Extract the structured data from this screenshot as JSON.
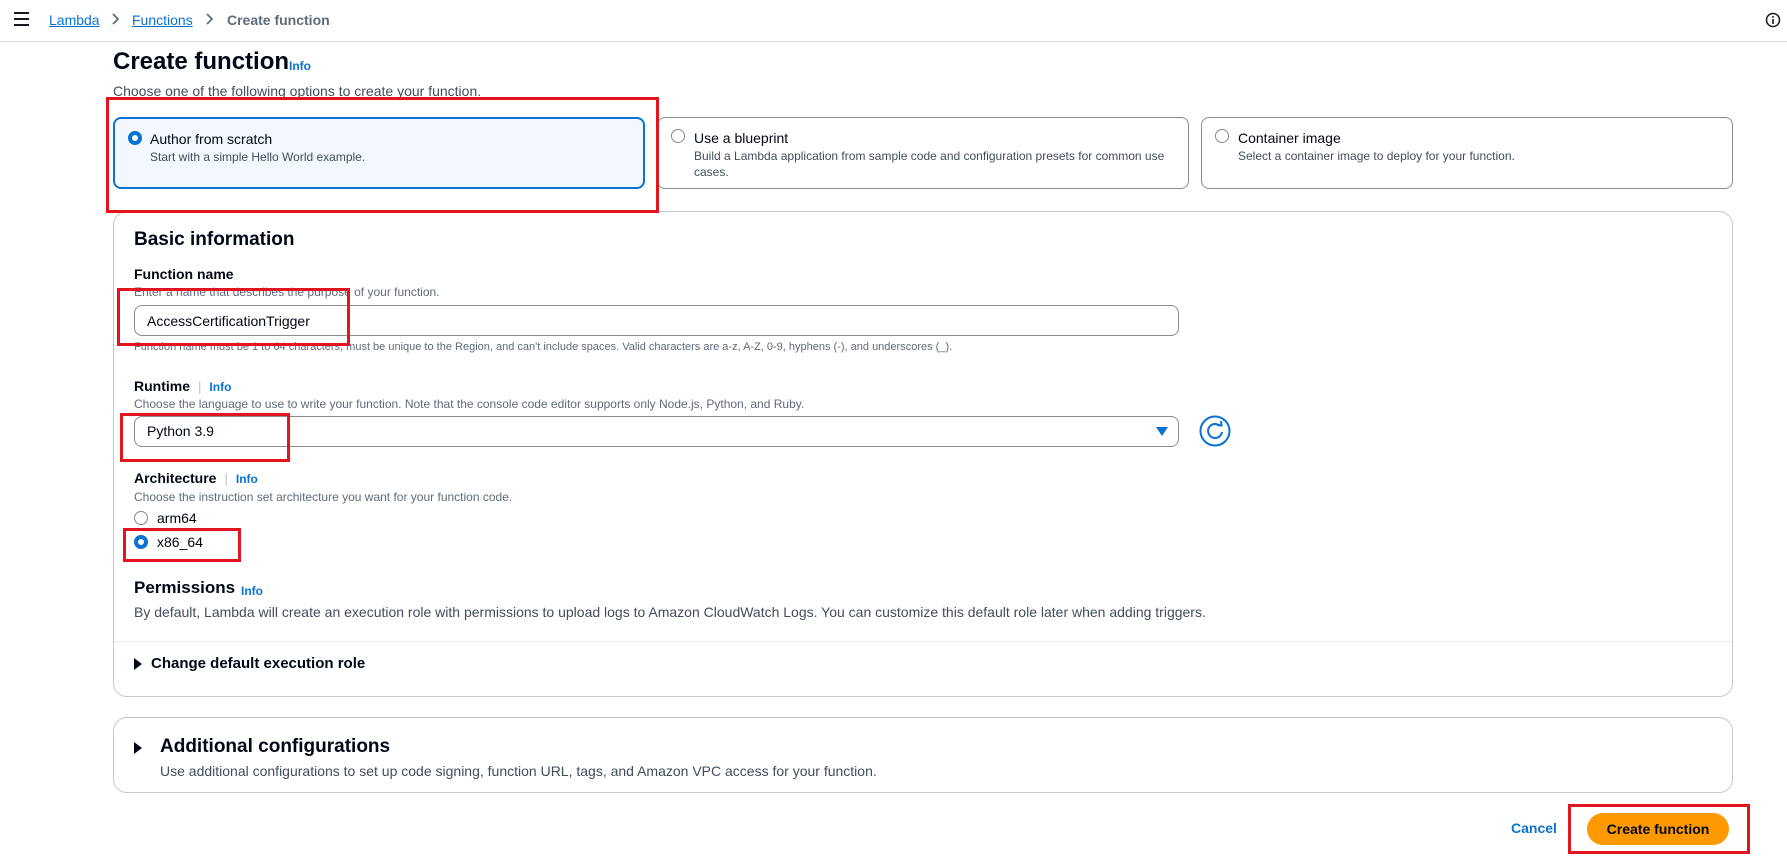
{
  "breadcrumb": {
    "items": [
      "Lambda",
      "Functions",
      "Create function"
    ]
  },
  "page": {
    "title": "Create function",
    "info": "Info",
    "description": "Choose one of the following options to create your function."
  },
  "options": [
    {
      "title": "Author from scratch",
      "description": "Start with a simple Hello World example.",
      "selected": true
    },
    {
      "title": "Use a blueprint",
      "description": "Build a Lambda application from sample code and configuration presets for common use cases.",
      "selected": false
    },
    {
      "title": "Container image",
      "description": "Select a container image to deploy for your function.",
      "selected": false
    }
  ],
  "basic_info": {
    "heading": "Basic information",
    "function_name": {
      "label": "Function name",
      "description": "Enter a name that describes the purpose of your function.",
      "value": "AccessCertificationTrigger",
      "constraint": "Function name must be 1 to 64 characters, must be unique to the Region, and can't include spaces. Valid characters are a-z, A-Z, 0-9, hyphens (-), and underscores (_)."
    },
    "runtime": {
      "label": "Runtime",
      "info": "Info",
      "description": "Choose the language to use to write your function. Note that the console code editor supports only Node.js, Python, and Ruby.",
      "value": "Python 3.9"
    },
    "architecture": {
      "label": "Architecture",
      "info": "Info",
      "description": "Choose the instruction set architecture you want for your function code.",
      "options": [
        {
          "label": "arm64",
          "selected": false
        },
        {
          "label": "x86_64",
          "selected": true
        }
      ]
    },
    "permissions": {
      "heading": "Permissions",
      "info": "Info",
      "description": "By default, Lambda will create an execution role with permissions to upload logs to Amazon CloudWatch Logs. You can customize this default role later when adding triggers."
    },
    "change_role": "Change default execution role"
  },
  "additional": {
    "heading": "Additional configurations",
    "description": "Use additional configurations to set up code signing, function URL, tags, and Amazon VPC access for your function."
  },
  "footer": {
    "cancel": "Cancel",
    "create": "Create function"
  },
  "colors": {
    "accent": "#0972d3",
    "primary_button": "#ff9900",
    "highlight": "#e1141f"
  }
}
